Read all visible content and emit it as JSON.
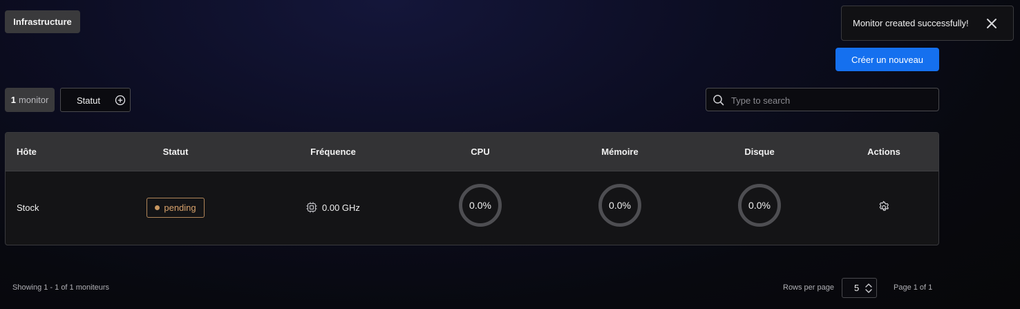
{
  "breadcrumb": {
    "label": "Infrastructure"
  },
  "toast": {
    "message": "Monitor created successfully!",
    "close_icon": "close-icon"
  },
  "header": {
    "create_label": "Créer un nouveau",
    "accent": "#1570ef"
  },
  "toolbar": {
    "count": "1",
    "count_label": "monitor",
    "filter_label": "Statut",
    "search_placeholder": "Type to search",
    "search_value": ""
  },
  "table": {
    "columns": [
      "Hôte",
      "Statut",
      "Fréquence",
      "CPU",
      "Mémoire",
      "Disque",
      "Actions"
    ],
    "rows": [
      {
        "host": "Stock",
        "status": "pending",
        "status_color": "#d9a36c",
        "frequency": "0.00 GHz",
        "cpu": "0.0%",
        "memory": "0.0%",
        "disk": "0.0%",
        "cpu_fraction": 0,
        "memory_fraction": 0,
        "disk_fraction": 0,
        "action_icon": "gear-icon"
      }
    ]
  },
  "footer": {
    "showing": "Showing 1 - 1 of 1 moniteurs",
    "rows_per_page_label": "Rows per page",
    "rows_per_page": "5",
    "page_info": "Page 1 of 1"
  }
}
